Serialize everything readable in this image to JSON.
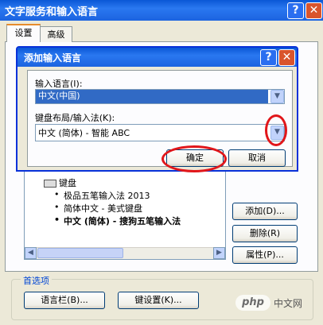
{
  "window": {
    "title": "文字服务和输入语言",
    "help_label": "?",
    "close_label": "✕"
  },
  "tabs": [
    {
      "label": "设置"
    },
    {
      "label": "高级"
    }
  ],
  "services": {
    "keyboard_label": "键盘",
    "items": [
      "极品五笔输入法 2013",
      "简体中文 - 美式键盘",
      "中文 (简体) - 搜狗五笔输入法"
    ],
    "add_label": "添加(D)...",
    "remove_label": "删除(R)",
    "properties_label": "属性(P)..."
  },
  "preferences": {
    "group_label": "首选项",
    "language_bar_label": "语言栏(B)...",
    "key_settings_label": "键设置(K)..."
  },
  "dialog": {
    "title": "添加输入语言",
    "help_label": "?",
    "close_label": "✕",
    "input_language_label": "输入语言(I):",
    "input_language_value": "中文(中国)",
    "keyboard_label": "键盘布局/输入法(K):",
    "keyboard_value": "中文 (简体) - 智能 ABC",
    "ok_label": "确定",
    "cancel_label": "取消"
  },
  "watermark": {
    "logo": "php",
    "text": "中文网"
  },
  "colors": {
    "titlebar": "#0a57d6",
    "highlight_ring": "#e1161a",
    "selection": "#316ac5"
  }
}
